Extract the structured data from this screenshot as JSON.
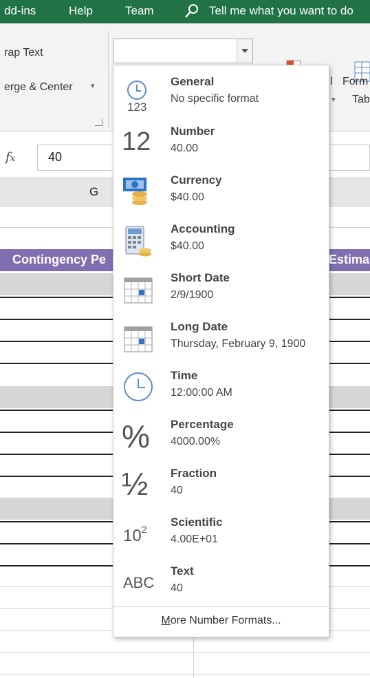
{
  "ribbon_tabs": [
    "dd-ins",
    "Help",
    "Team"
  ],
  "tell_me": "Tell me what you want to do",
  "ribbon": {
    "wrap_text": "rap Text",
    "merge_center": "erge & Center",
    "cond_label": "l",
    "format_as_label1": "Form",
    "format_as_label2": "Tab",
    "number_format_value": ""
  },
  "formula_bar": {
    "fx": "fx",
    "value": "40"
  },
  "column_header": "G",
  "sheet": {
    "header_left": "Contingency Pe",
    "header_right": "Estima"
  },
  "dropdown": {
    "items": [
      {
        "title": "General",
        "sub": "No specific format",
        "icon": "general-icon"
      },
      {
        "title": "Number",
        "sub": "40.00",
        "icon": "number-icon"
      },
      {
        "title": "Currency",
        "sub": "$40.00",
        "icon": "currency-icon"
      },
      {
        "title": "Accounting",
        "sub": " $40.00",
        "icon": "accounting-icon"
      },
      {
        "title": "Short Date",
        "sub": "2/9/1900",
        "icon": "short-date-icon"
      },
      {
        "title": "Long Date",
        "sub": "Thursday, February 9, 1900",
        "icon": "long-date-icon"
      },
      {
        "title": "Time",
        "sub": "12:00:00 AM",
        "icon": "time-icon"
      },
      {
        "title": "Percentage",
        "sub": "4000.00%",
        "icon": "percentage-icon"
      },
      {
        "title": "Fraction",
        "sub": "40",
        "icon": "fraction-icon"
      },
      {
        "title": "Scientific",
        "sub": "4.00E+01",
        "icon": "scientific-icon"
      },
      {
        "title": "Text",
        "sub": "40",
        "icon": "text-icon"
      }
    ],
    "more_prefix": "M",
    "more_rest": "ore Number Formats..."
  },
  "icon_glyphs": {
    "general": "123",
    "number": "12",
    "percent": "%",
    "fraction": "½",
    "sci_base": "10",
    "sci_exp": "2",
    "text": "ABC"
  },
  "colors": {
    "ribbon_green": "#217346",
    "header_purple": "#7f6fb0"
  }
}
